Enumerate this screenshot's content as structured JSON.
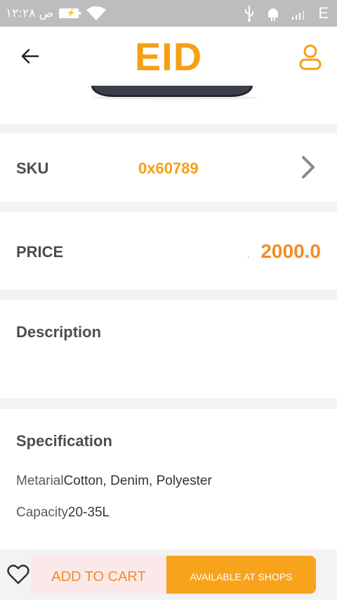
{
  "status_bar": {
    "time": "ص ١٢:٢٨",
    "carrier": "E"
  },
  "header": {
    "title": "EID",
    "accent_color": "#f5a014"
  },
  "product": {
    "sku_label": "SKU",
    "sku_value": "0x60789",
    "price_label": "PRICE",
    "price_value": "2000.0",
    "price_prefix": ".",
    "description_label": "Description",
    "description_text": "",
    "specification_label": "Specification",
    "specs": [
      {
        "key": "Metarial",
        "value": "Cotton, Denim, Polyester"
      },
      {
        "key": "Capacity",
        "value": "20-35L"
      }
    ]
  },
  "actions": {
    "add_to_cart": "ADD TO CART",
    "available_at_shops": "AVAILABLE AT SHOPS"
  },
  "icons": {
    "back": "arrow-left-icon",
    "user": "user-icon",
    "chevron": "chevron-right-icon",
    "wishlist": "heart-icon"
  }
}
